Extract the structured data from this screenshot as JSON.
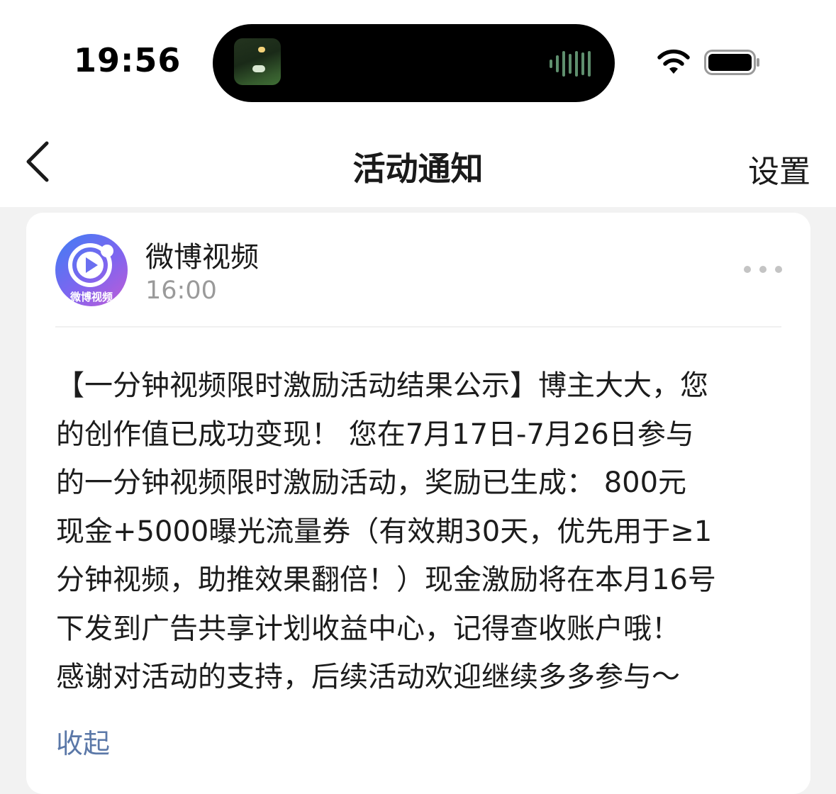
{
  "status_bar": {
    "time": "19:56",
    "icons": [
      "album-thumbnail-icon",
      "audio-waveform-icon",
      "wifi-icon",
      "battery-icon"
    ]
  },
  "nav": {
    "title": "活动通知",
    "settings_label": "设置",
    "back_icon": "chevron-left-icon"
  },
  "message": {
    "sender": "微博视频",
    "avatar_label": "微博视频",
    "time": "16:00",
    "more_icon": "ellipsis-icon",
    "lines": [
      "【一分钟视频限时激励活动结果公示】博主大大，您",
      "的创作值已成功变现！ 您在7月17日-7月26日参与",
      "的一分钟视频限时激励活动，奖励已生成： 800元",
      "现金+5000曝光流量券（有效期30天，优先用于≥1",
      "分钟视频，助推效果翻倍！）现金激励将在本月16号",
      "下发到广告共享计划收益中心，记得查收账户哦！",
      "感谢对活动的支持，后续活动欢迎继续多多参与～"
    ],
    "collapse_label": "收起"
  },
  "colors": {
    "link": "#5b78a8",
    "background": "#f2f2f2",
    "card": "#ffffff"
  }
}
